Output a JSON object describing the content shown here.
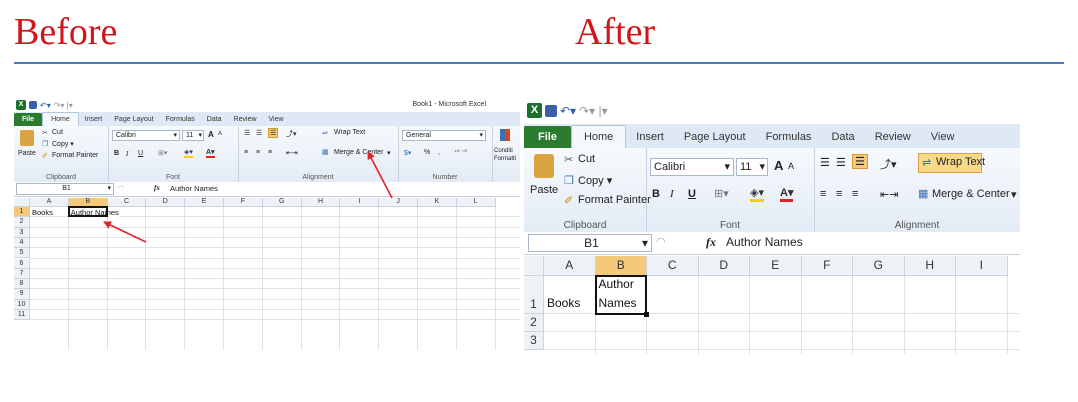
{
  "labels": {
    "before": "Before",
    "after": "After"
  },
  "excel": {
    "window_title": "Book1 - Microsoft Excel",
    "tabs": [
      "File",
      "Home",
      "Insert",
      "Page Layout",
      "Formulas",
      "Data",
      "Review",
      "View"
    ],
    "clipboard": {
      "paste": "Paste",
      "cut": "Cut",
      "copy": "Copy ▾",
      "format_painter": "Format Painter",
      "group": "Clipboard"
    },
    "font": {
      "name": "Calibri",
      "size": "11",
      "bold": "B",
      "italic": "I",
      "underline": "U",
      "grow": "A",
      "shrink": "A",
      "group": "Font"
    },
    "alignment": {
      "wrap_text": "Wrap Text",
      "merge_center": "Merge & Center",
      "group": "Alignment"
    },
    "number": {
      "format": "General",
      "percent": "%",
      "comma": ",",
      "group": "Number"
    },
    "styles": {
      "conditional": "Conditi",
      "formatting": "Formatti"
    },
    "formula_bar": {
      "name_box": "B1",
      "fx": "fx",
      "content": "Author Names"
    },
    "columns": [
      "A",
      "B",
      "C",
      "D",
      "E",
      "F",
      "G",
      "H",
      "I",
      "J",
      "K",
      "L"
    ],
    "cells": {
      "a1": "Books",
      "b1": "Author Names",
      "b1_line1": "Author",
      "b1_line2": "Names"
    },
    "before_rows": [
      "1",
      "2",
      "3",
      "4",
      "5",
      "6",
      "7",
      "8",
      "9",
      "10",
      "11"
    ],
    "after_rows": [
      "1",
      "2",
      "3"
    ]
  },
  "colors": {
    "heading": "#d0161b",
    "rule": "#4a79c2",
    "arrow": "#e0262b",
    "file_tab": "#2b7c2e",
    "selected_header": "#f5c97a"
  }
}
